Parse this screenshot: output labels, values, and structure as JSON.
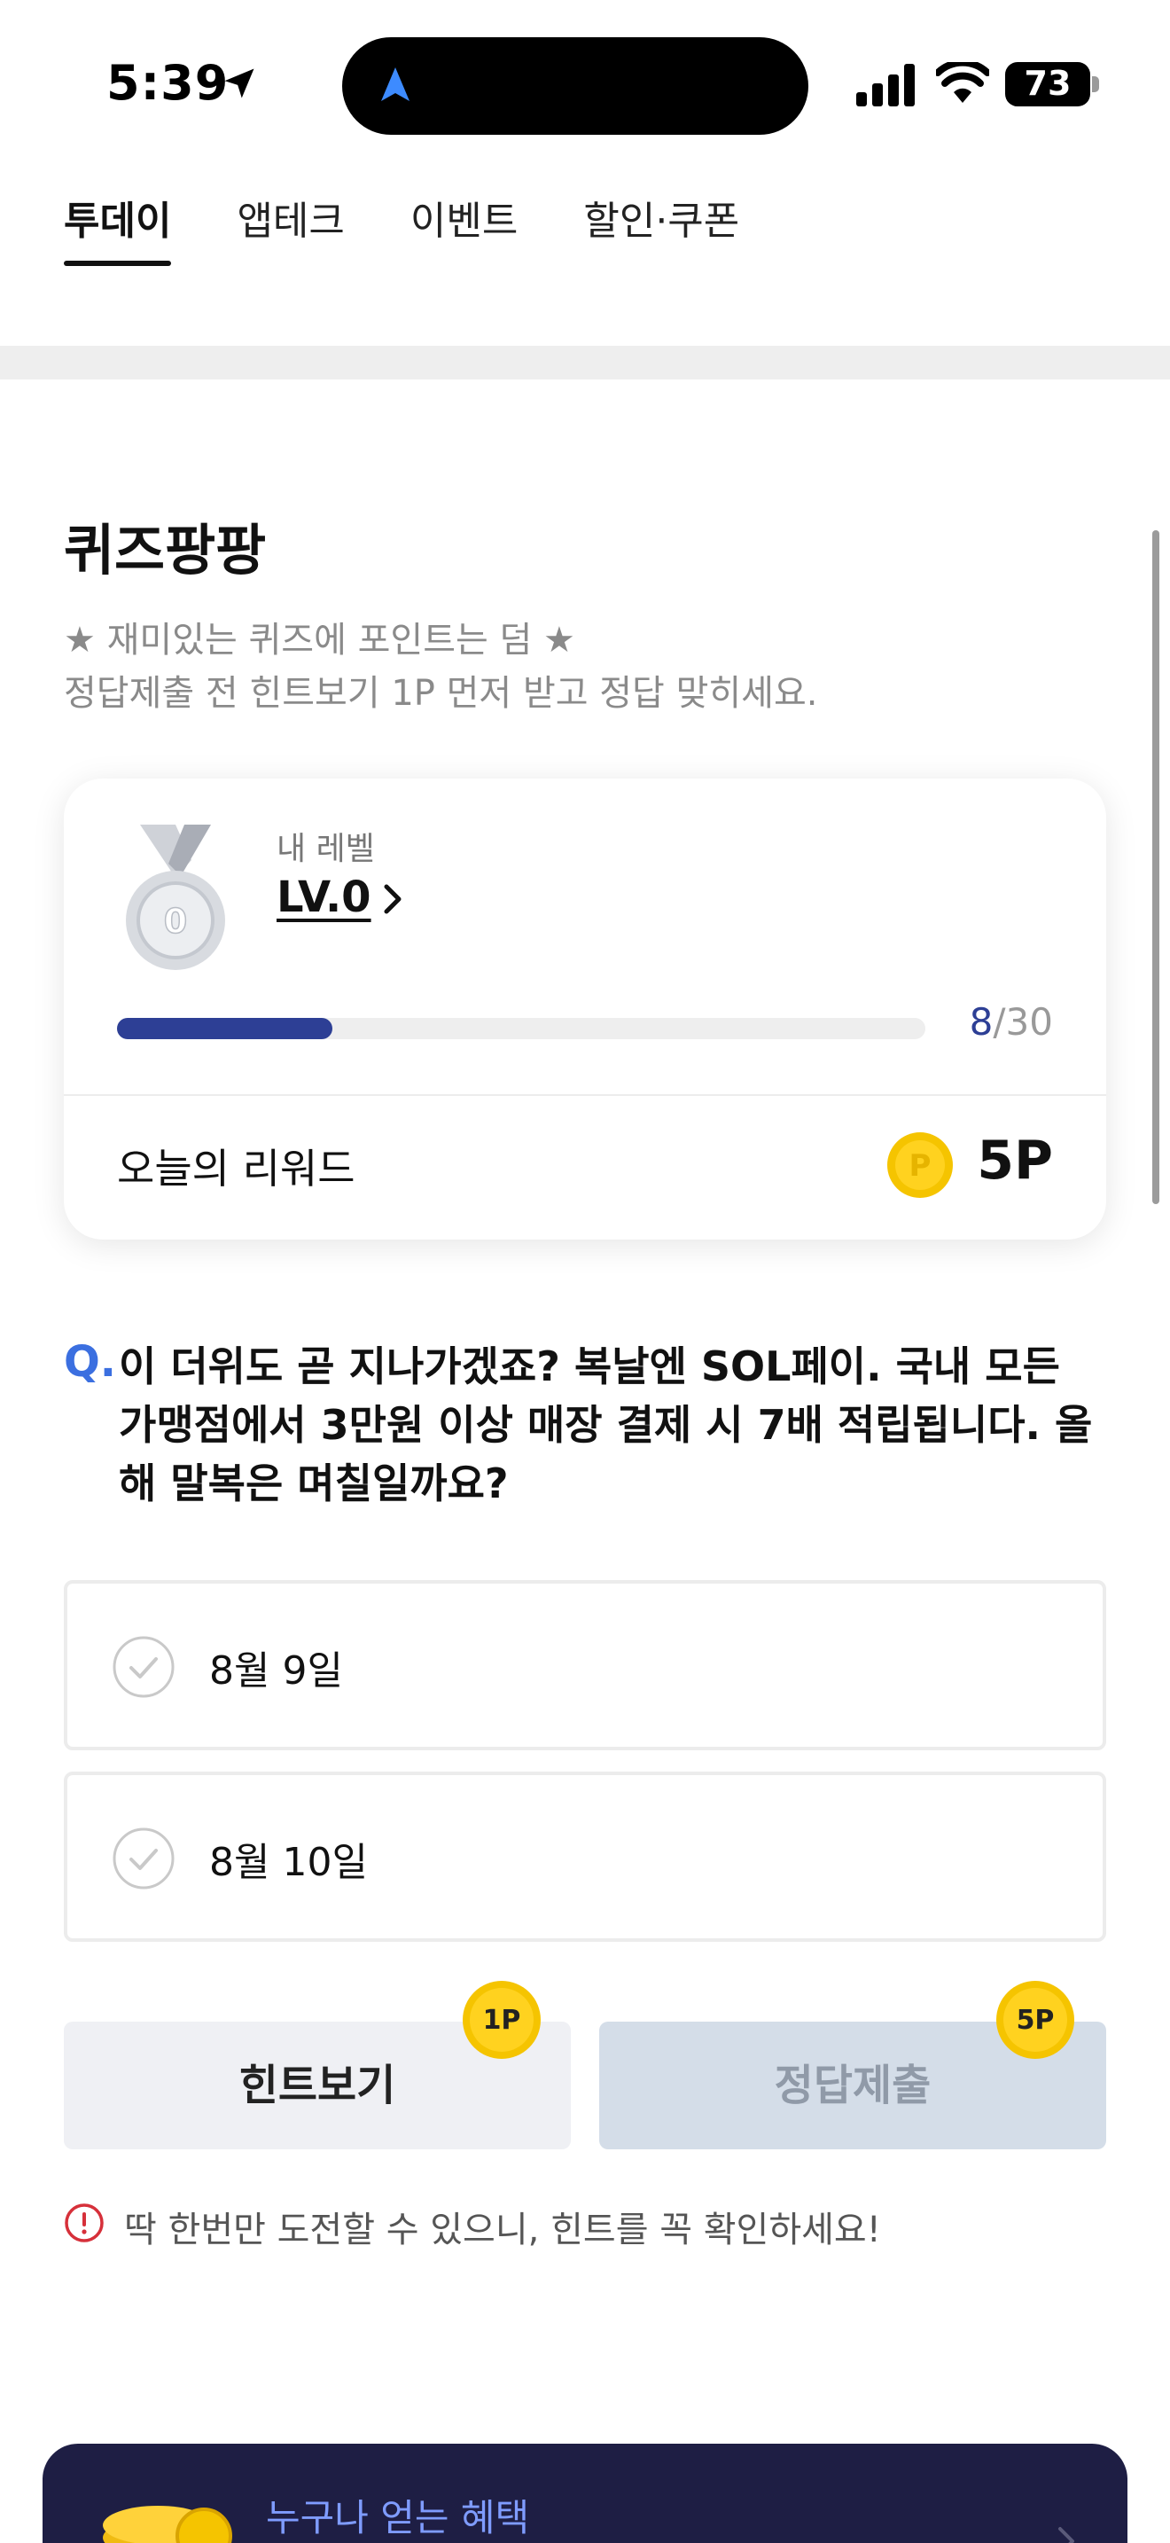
{
  "status": {
    "time": "5:39",
    "battery": "73"
  },
  "tabs": [
    {
      "label": "투데이",
      "active": true
    },
    {
      "label": "앱테크",
      "active": false
    },
    {
      "label": "이벤트",
      "active": false
    },
    {
      "label": "할인·쿠폰",
      "active": false
    }
  ],
  "quiz": {
    "title": "퀴즈팡팡",
    "desc_line1": "★ 재미있는 퀴즈에 포인트는 덤 ★",
    "desc_line2": "정답제출 전 힌트보기 1P 먼저 받고 정답 맞히세요."
  },
  "level": {
    "medal_number": "0",
    "caption": "내 레벨",
    "value": "LV.0",
    "progress_current": "8",
    "progress_total": "/30",
    "progress_fraction": 0.2667,
    "reward_label": "오늘의 리워드",
    "coin_symbol": "P",
    "reward_value": "5P"
  },
  "question": {
    "marker": "Q.",
    "text": "이 더위도 곧 지나가겠죠? 복날엔 SOL페이. 국내 모든 가맹점에서 3만원 이상 매장 결제 시 7배 적립됩니다. 올해 말복은 며칠일까요?"
  },
  "options": [
    {
      "label": "8월 9일"
    },
    {
      "label": "8월 10일"
    }
  ],
  "buttons": {
    "hint_label": "힌트보기",
    "hint_badge": "1P",
    "submit_label": "정답제출",
    "submit_badge": "5P"
  },
  "warning": "딱 한번만 도전할 수 있으니, 힌트를 꼭 확인하세요!",
  "banner": {
    "text": "누구나 얻는 혜택"
  },
  "colors": {
    "accent_blue": "#2d3f95",
    "question_blue": "#3b6fe0",
    "coin_gold": "#f5c400",
    "warn_red": "#d6303a",
    "banner_bg": "#1e1e44"
  }
}
